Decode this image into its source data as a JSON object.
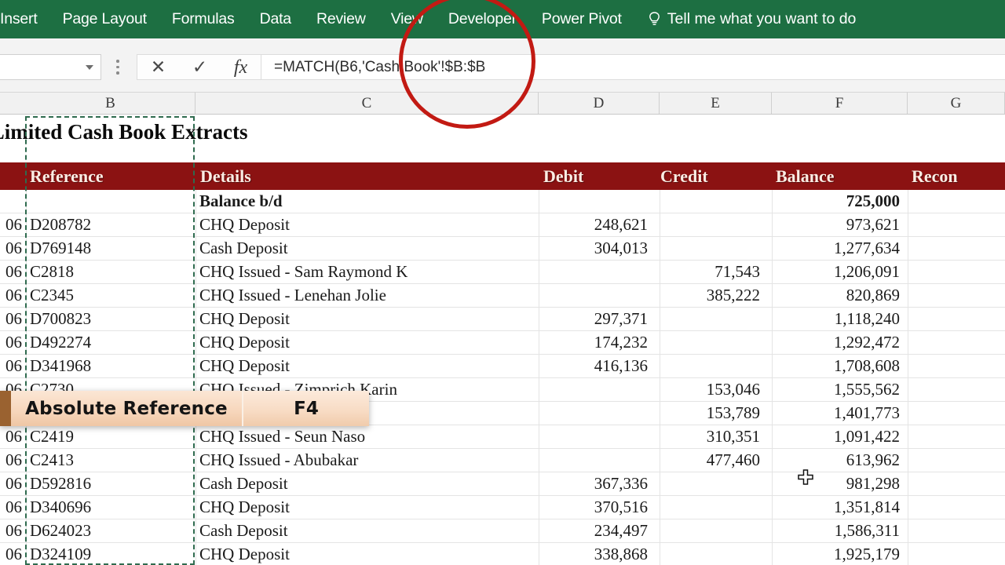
{
  "ribbon": {
    "tabs": [
      {
        "label": "Insert",
        "active": false
      },
      {
        "label": "Page Layout",
        "active": false
      },
      {
        "label": "Formulas",
        "active": false
      },
      {
        "label": "Data",
        "active": false
      },
      {
        "label": "Review",
        "active": false
      },
      {
        "label": "View",
        "active": false
      },
      {
        "label": "Developer",
        "active": false
      },
      {
        "label": "Power Pivot",
        "active": false
      }
    ],
    "tell_me": "Tell me what you want to do",
    "tell_me_icon": "lightbulb-icon",
    "background_color": "#1D6F42"
  },
  "formula_bar": {
    "name_box_value": "",
    "cancel_icon": "✕",
    "enter_icon": "✓",
    "function_icon": "fx",
    "formula": "=MATCH(B6,'Cash Book'!$B:$B"
  },
  "sheet": {
    "column_headers": [
      "B",
      "C",
      "D",
      "E",
      "F",
      "G"
    ],
    "title": "d Limited Cash Book Extracts",
    "header_band_color": "#8B1212",
    "recon_fill_color": "#CBF3F7",
    "selection_color": "#2f6b4f",
    "table_headers": {
      "reference": "Reference",
      "details": "Details",
      "debit": "Debit",
      "credit": "Credit",
      "balance": "Balance",
      "recon": "Recon"
    },
    "rows": [
      {
        "date": "",
        "reference": "",
        "details": "Balance b/d",
        "debit": "",
        "credit": "",
        "balance": "725,000",
        "bold": true
      },
      {
        "date": "06",
        "reference": "D208782",
        "details": "CHQ Deposit",
        "debit": "248,621",
        "credit": "",
        "balance": "973,621",
        "bold": false
      },
      {
        "date": "06",
        "reference": "D769148",
        "details": "Cash Deposit",
        "debit": "304,013",
        "credit": "",
        "balance": "1,277,634",
        "bold": false
      },
      {
        "date": "06",
        "reference": "C2818",
        "details": "CHQ Issued - Sam Raymond K",
        "debit": "",
        "credit": "71,543",
        "balance": "1,206,091",
        "bold": false
      },
      {
        "date": "06",
        "reference": "C2345",
        "details": "CHQ Issued - Lenehan Jolie",
        "debit": "",
        "credit": "385,222",
        "balance": "820,869",
        "bold": false
      },
      {
        "date": "06",
        "reference": "D700823",
        "details": "CHQ Deposit",
        "debit": "297,371",
        "credit": "",
        "balance": "1,118,240",
        "bold": false
      },
      {
        "date": "06",
        "reference": "D492274",
        "details": "CHQ Deposit",
        "debit": "174,232",
        "credit": "",
        "balance": "1,292,472",
        "bold": false
      },
      {
        "date": "06",
        "reference": "D341968",
        "details": "CHQ Deposit",
        "debit": "416,136",
        "credit": "",
        "balance": "1,708,608",
        "bold": false
      },
      {
        "date": "06",
        "reference": "C2730",
        "details": "CHQ Issued - Zimprich Karin",
        "debit": "",
        "credit": "153,046",
        "balance": "1,555,562",
        "bold": false
      },
      {
        "date": "06",
        "reference": "",
        "details": "berg Beth",
        "debit": "",
        "credit": "153,789",
        "balance": "1,401,773",
        "bold": false
      },
      {
        "date": "06",
        "reference": "C2419",
        "details": "CHQ Issued - Seun Naso",
        "debit": "",
        "credit": "310,351",
        "balance": "1,091,422",
        "bold": false
      },
      {
        "date": "06",
        "reference": "C2413",
        "details": "CHQ Issued - Abubakar",
        "debit": "",
        "credit": "477,460",
        "balance": "613,962",
        "bold": false
      },
      {
        "date": "06",
        "reference": "D592816",
        "details": "Cash Deposit",
        "debit": "367,336",
        "credit": "",
        "balance": "981,298",
        "bold": false
      },
      {
        "date": "06",
        "reference": "D340696",
        "details": "CHQ Deposit",
        "debit": "370,516",
        "credit": "",
        "balance": "1,351,814",
        "bold": false
      },
      {
        "date": "06",
        "reference": "D624023",
        "details": "Cash Deposit",
        "debit": "234,497",
        "credit": "",
        "balance": "1,586,311",
        "bold": false
      },
      {
        "date": "06",
        "reference": "D324109",
        "details": "CHQ Deposit",
        "debit": "338,868",
        "credit": "",
        "balance": "1,925,179",
        "bold": false
      }
    ]
  },
  "annotations": {
    "circle_color": "#C21A13",
    "callout": {
      "label": "Absolute Reference",
      "key": "F4",
      "accent_color": "#9A6230"
    },
    "cursor_icon": "excel-plus-cursor"
  }
}
